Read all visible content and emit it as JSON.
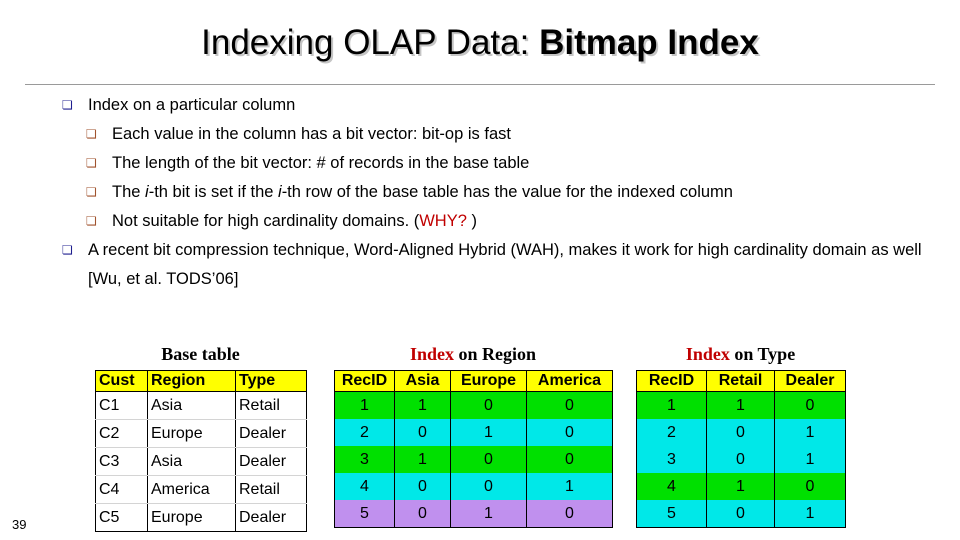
{
  "slide": {
    "title_plain": "Indexing OLAP Data: ",
    "title_bold": "Bitmap Index",
    "page_number": "39"
  },
  "bullets": [
    {
      "level": 1,
      "marker": "square-bullet-icon",
      "marker_glyph": "❏",
      "color": "#1f1f8f",
      "text": "Index on a particular column"
    },
    {
      "level": 2,
      "marker": "square-bullet-icon",
      "marker_glyph": "❏",
      "color": "#a0522d",
      "text": "Each value in the column has a bit vector: bit-op is fast"
    },
    {
      "level": 2,
      "marker": "square-bullet-icon",
      "marker_glyph": "❏",
      "color": "#a0522d",
      "text": "The length of the bit vector: # of records in the base table"
    },
    {
      "level": 2,
      "marker": "square-bullet-icon",
      "marker_glyph": "❏",
      "color": "#a0522d",
      "text_pre": "The  ",
      "text_ital1": "i",
      "text_mid1": "-th bit is set if the  ",
      "text_ital2": "i",
      "text_post": "-th row of the base table has the value for the indexed column"
    },
    {
      "level": 2,
      "marker": "square-bullet-icon",
      "marker_glyph": "❏",
      "color": "#a0522d",
      "text_pre": "Not suitable for high cardinality domains. (",
      "text_highlight": "WHY?",
      "text_post": " )",
      "highlight_color": "#c00000"
    },
    {
      "level": 1,
      "marker": "square-bullet-icon",
      "marker_glyph": "❏",
      "color": "#1f1f8f",
      "text": "A recent bit compression technique, Word-Aligned Hybrid (WAH), makes it work for high cardinality domain as well [Wu, et al. TODS’06]"
    }
  ],
  "base_table": {
    "caption": "Base table",
    "caption_red": "",
    "caption_rest": "Base table",
    "headers": [
      "Cust",
      "Region",
      "Type"
    ],
    "rows": [
      [
        "C1",
        "Asia",
        "Retail"
      ],
      [
        "C2",
        "Europe",
        "Dealer"
      ],
      [
        "C3",
        "Asia",
        "Dealer"
      ],
      [
        "C4",
        "America",
        "Retail"
      ],
      [
        "C5",
        "Europe",
        "Dealer"
      ]
    ]
  },
  "region_index": {
    "caption_red": "Index",
    "caption_rest": " on Region",
    "headers": [
      "RecID",
      "Asia",
      "Europe",
      "America"
    ],
    "rows": [
      [
        "1",
        "1",
        "0",
        "0"
      ],
      [
        "2",
        "0",
        "1",
        "0"
      ],
      [
        "3",
        "1",
        "0",
        "0"
      ],
      [
        "4",
        "0",
        "0",
        "1"
      ],
      [
        "5",
        "0",
        "1",
        "0"
      ]
    ],
    "row_colors": [
      "#00e000",
      "#00e8e8",
      "#00e000",
      "#00e8e8",
      "#c090ee"
    ]
  },
  "type_index": {
    "caption_red": "Index",
    "caption_rest": " on Type",
    "headers": [
      "RecID",
      "Retail",
      "Dealer"
    ],
    "rows": [
      [
        "1",
        "1",
        "0"
      ],
      [
        "2",
        "0",
        "1"
      ],
      [
        "3",
        "0",
        "1"
      ],
      [
        "4",
        "1",
        "0"
      ],
      [
        "5",
        "0",
        "1"
      ]
    ],
    "row_colors": [
      "#00e000",
      "#00e8e8",
      "#00e8e8",
      "#00e000",
      "#00e8e8"
    ]
  },
  "colors": {
    "header_yellow": "#ffff00",
    "green": "#00e000",
    "cyan": "#00e8e8",
    "purple": "#c090ee",
    "accent_red": "#c00000",
    "bullet_navy": "#1f1f8f",
    "bullet_sienna": "#a0522d"
  }
}
